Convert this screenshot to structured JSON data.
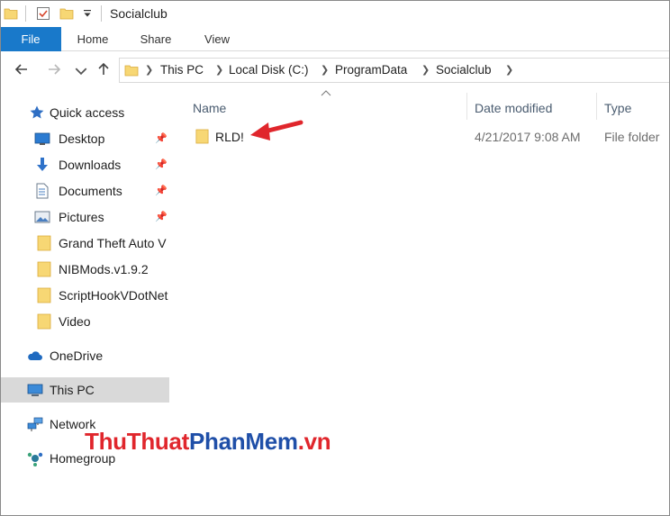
{
  "window": {
    "title": "Socialclub"
  },
  "ribbon": {
    "tabs": [
      {
        "label": "File"
      },
      {
        "label": "Home"
      },
      {
        "label": "Share"
      },
      {
        "label": "View"
      }
    ]
  },
  "address": {
    "crumbs": [
      "This PC",
      "Local Disk (C:)",
      "ProgramData",
      "Socialclub"
    ]
  },
  "sidebar": {
    "quick_access": "Quick access",
    "items": [
      {
        "label": "Desktop",
        "icon": "desktop-icon",
        "pinned": true
      },
      {
        "label": "Downloads",
        "icon": "download-icon",
        "pinned": true
      },
      {
        "label": "Documents",
        "icon": "documents-icon",
        "pinned": true
      },
      {
        "label": "Pictures",
        "icon": "pictures-icon",
        "pinned": true
      },
      {
        "label": "Grand Theft Auto V",
        "icon": "folder-icon",
        "pinned": false
      },
      {
        "label": "NIBMods.v1.9.2",
        "icon": "folder-icon",
        "pinned": false
      },
      {
        "label": "ScriptHookVDotNet",
        "icon": "folder-icon",
        "pinned": false
      },
      {
        "label": "Video",
        "icon": "folder-icon",
        "pinned": false
      }
    ],
    "onedrive": "OneDrive",
    "this_pc": "This PC",
    "network": "Network",
    "homegroup": "Homegroup"
  },
  "content": {
    "columns": {
      "name": "Name",
      "date": "Date modified",
      "type": "Type"
    },
    "rows": [
      {
        "name": "RLD!",
        "date": "4/21/2017 9:08 AM",
        "type": "File folder"
      }
    ]
  },
  "watermark": {
    "part1": "ThuThuat",
    "part2": "PhanMem",
    "part3": ".vn"
  },
  "colors": {
    "accent": "#1979ca",
    "folder": "#f7d774",
    "annotation": "#e0262c"
  }
}
